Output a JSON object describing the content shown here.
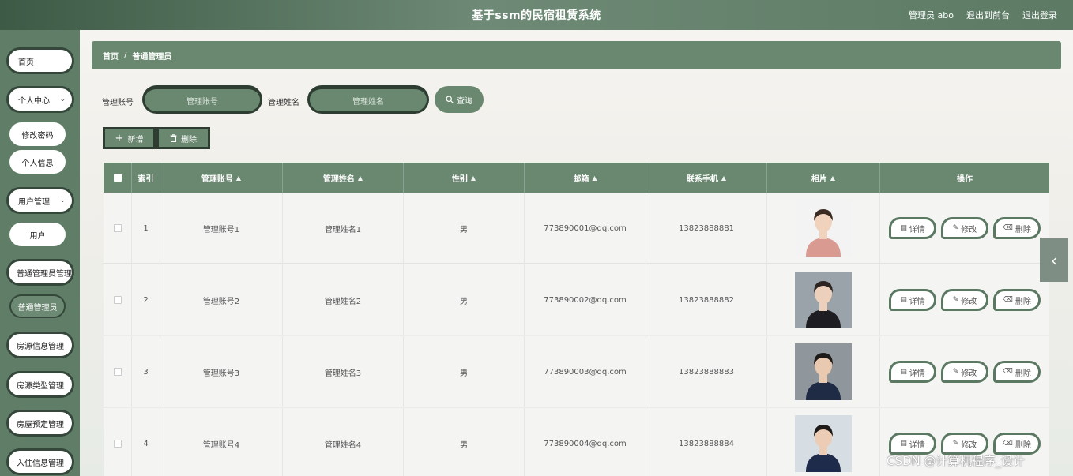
{
  "header": {
    "title": "基于ssm的民宿租赁系统",
    "user_label": "管理员 abo",
    "to_front": "退出到前台",
    "logout": "退出登录"
  },
  "sidebar": {
    "home": "首页",
    "personal_center": "个人中心",
    "change_password": "修改密码",
    "personal_info": "个人信息",
    "user_mgmt": "用户管理",
    "user": "用户",
    "admin_mgmt": "普通管理员管理",
    "admin": "普通管理员",
    "house_info_mgmt": "房源信息管理",
    "house_type_mgmt": "房源类型管理",
    "booking_mgmt": "房屋预定管理",
    "checkin_mgmt": "入住信息管理"
  },
  "breadcrumb": {
    "home": "首页",
    "sep": "/",
    "current": "普通管理员"
  },
  "search": {
    "account_label": "管理账号",
    "account_placeholder": "管理账号",
    "name_label": "管理姓名",
    "name_placeholder": "管理姓名",
    "query": "查询"
  },
  "actions": {
    "add": "新增",
    "delete": "删除"
  },
  "table": {
    "headers": {
      "index": "索引",
      "account": "管理账号",
      "name": "管理姓名",
      "gender": "性别",
      "email": "邮箱",
      "phone": "联系手机",
      "photo": "相片",
      "ops": "操作"
    },
    "ops": {
      "detail": "详情",
      "edit": "修改",
      "delete": "删除"
    },
    "rows": [
      {
        "index": "1",
        "account": "管理账号1",
        "name": "管理姓名1",
        "gender": "男",
        "email": "773890001@qq.com",
        "phone": "13823888881"
      },
      {
        "index": "2",
        "account": "管理账号2",
        "name": "管理姓名2",
        "gender": "男",
        "email": "773890002@qq.com",
        "phone": "13823888882"
      },
      {
        "index": "3",
        "account": "管理账号3",
        "name": "管理姓名3",
        "gender": "男",
        "email": "773890003@qq.com",
        "phone": "13823888883"
      },
      {
        "index": "4",
        "account": "管理账号4",
        "name": "管理姓名4",
        "gender": "男",
        "email": "773890004@qq.com",
        "phone": "13823888884"
      }
    ]
  },
  "watermark": "CSDN @计算机程序_设计",
  "colors": {
    "primary": "#6a8870",
    "dark": "#2d3d32",
    "sidebar": "#5f7d67"
  },
  "icons": {
    "search": "search-icon",
    "plus": "plus-icon",
    "trash": "trash-icon",
    "chevron": "chevron-left-icon"
  }
}
